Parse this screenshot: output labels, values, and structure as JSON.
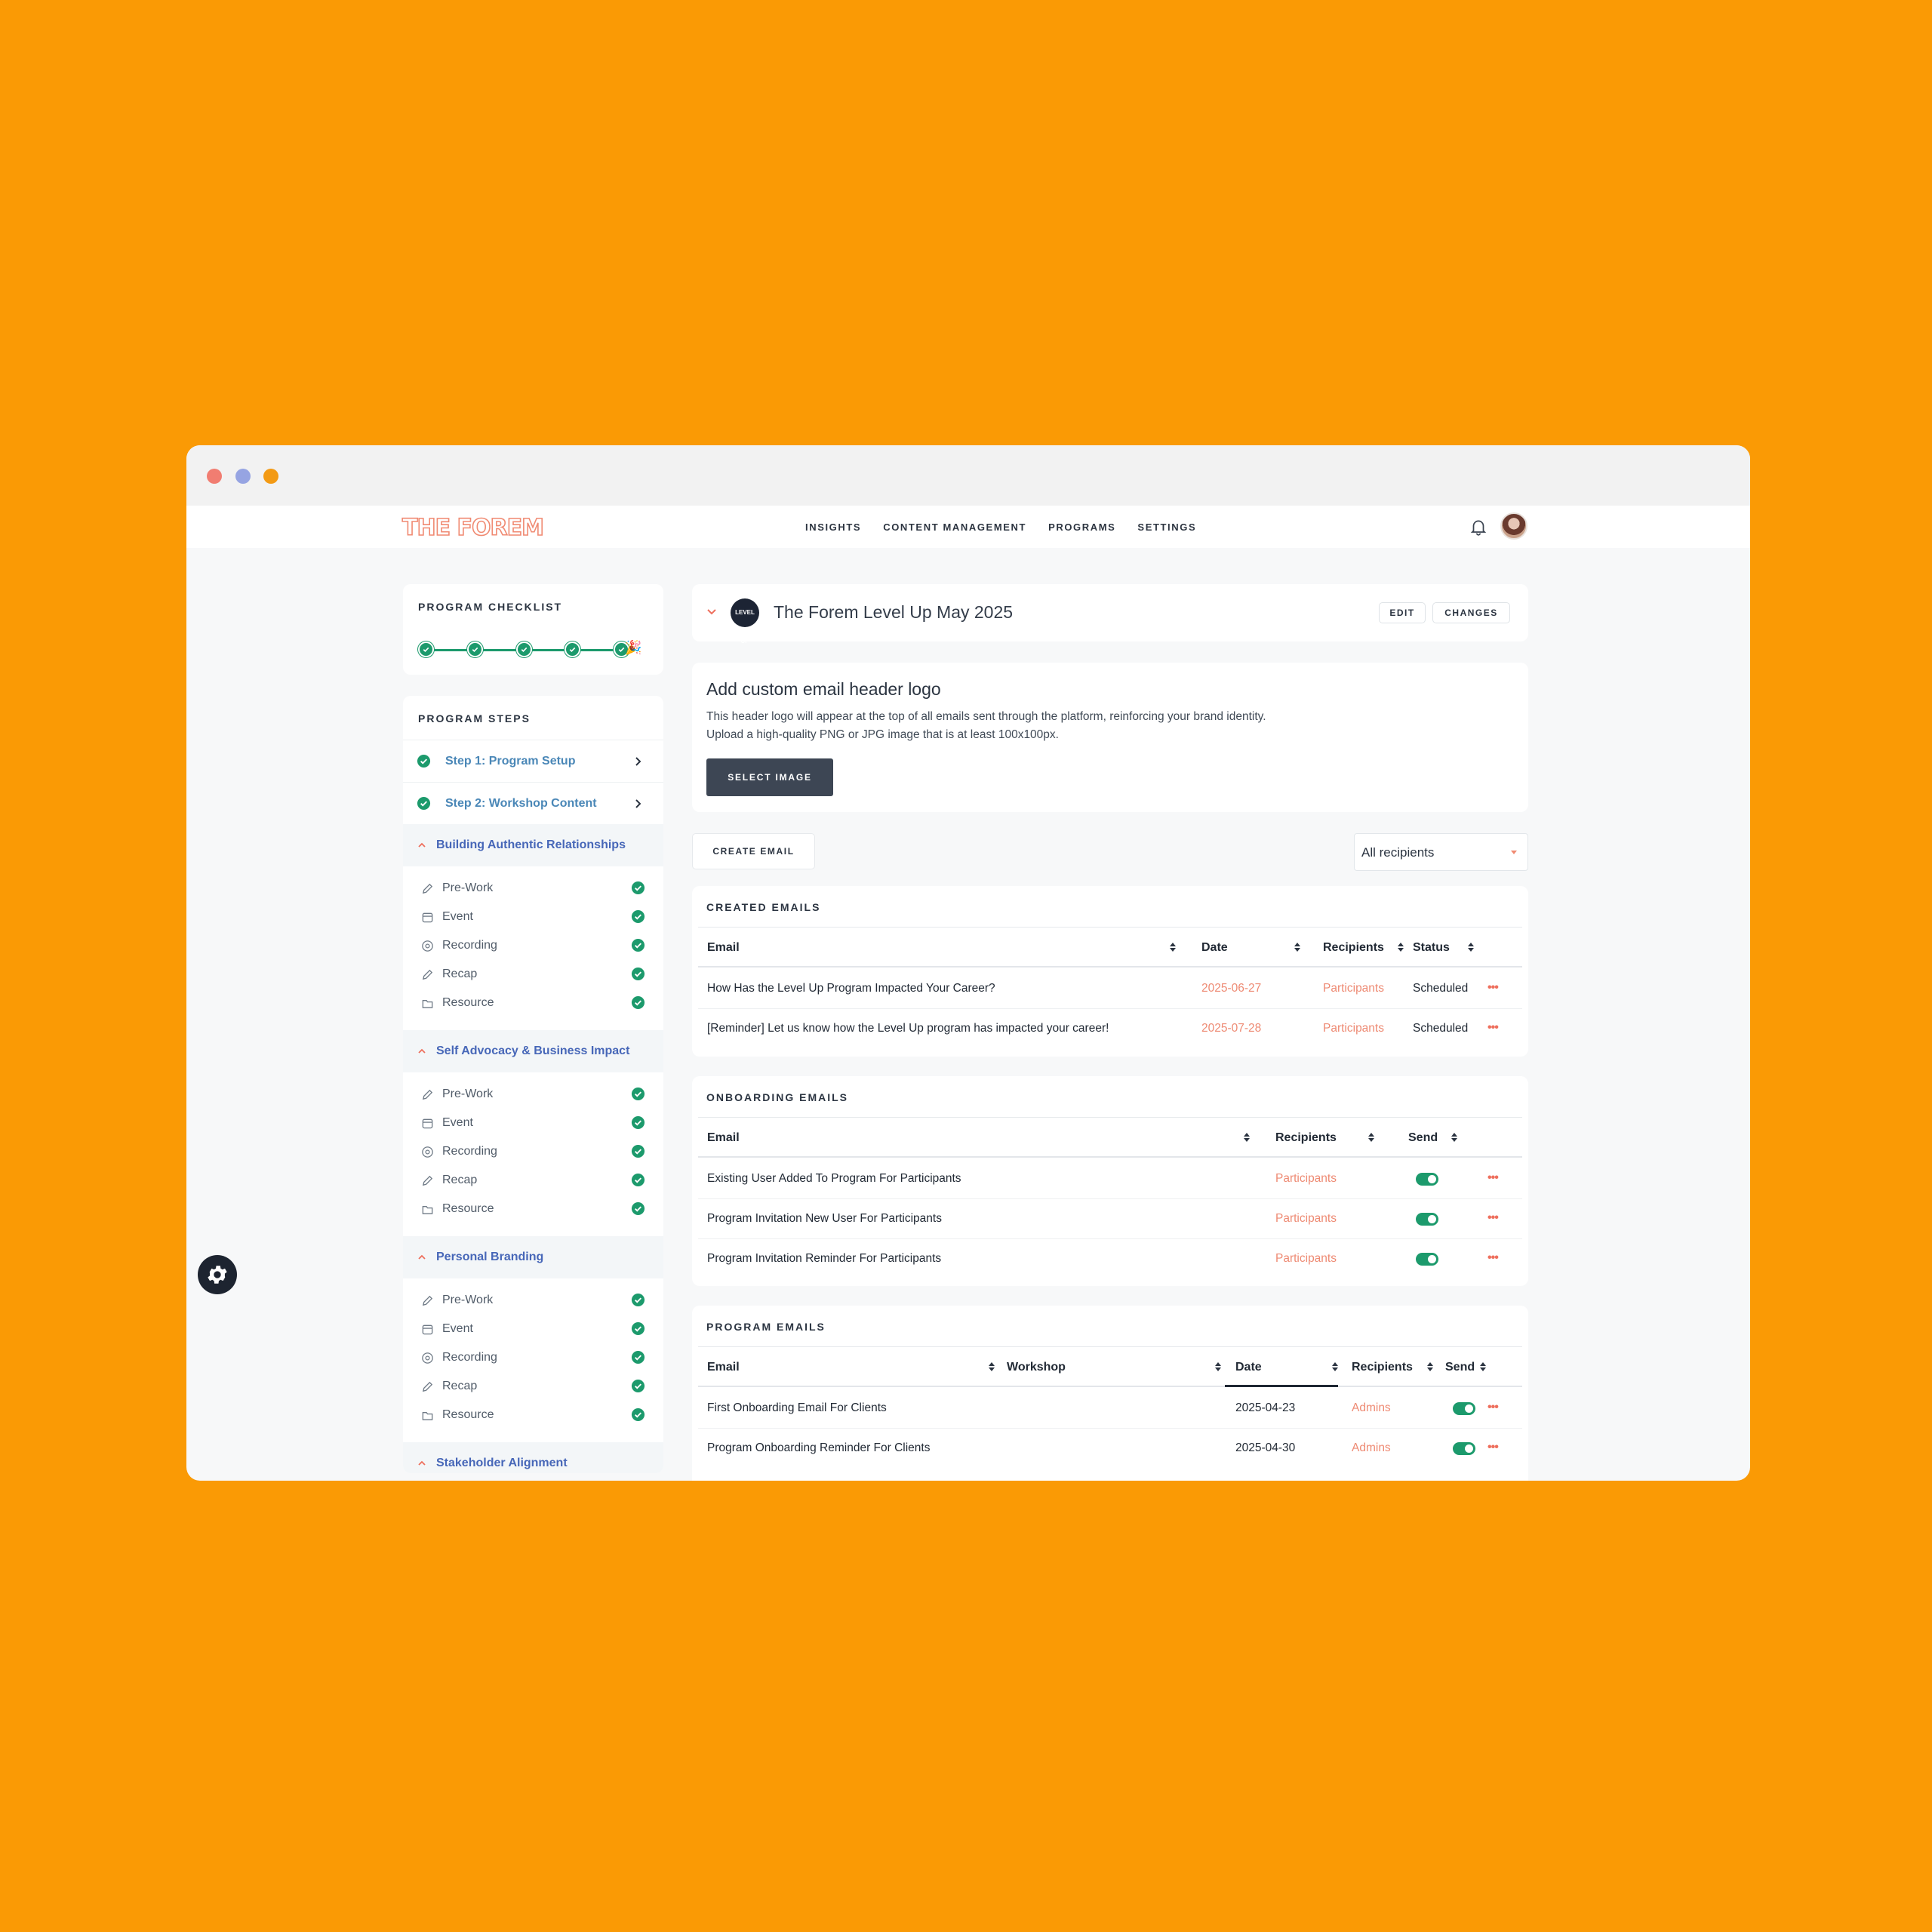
{
  "nav": {
    "logo": "THE FOREM",
    "items": [
      "INSIGHTS",
      "CONTENT MANAGEMENT",
      "PROGRAMS",
      "SETTINGS"
    ]
  },
  "checklist": {
    "title": "PROGRAM CHECKLIST",
    "completed_steps": 5,
    "total_steps": 5
  },
  "steps": {
    "title": "PROGRAM STEPS",
    "step1": "Step 1: Program Setup",
    "step2": "Step 2: Workshop Content",
    "groups": [
      {
        "label": "Building Authentic Relationships",
        "items": [
          "Pre-Work",
          "Event",
          "Recording",
          "Recap",
          "Resource"
        ]
      },
      {
        "label": "Self Advocacy & Business Impact",
        "items": [
          "Pre-Work",
          "Event",
          "Recording",
          "Recap",
          "Resource"
        ]
      },
      {
        "label": "Personal Branding",
        "items": [
          "Pre-Work",
          "Event",
          "Recording",
          "Recap",
          "Resource"
        ]
      },
      {
        "label": "Stakeholder Alignment",
        "items": []
      }
    ]
  },
  "program": {
    "title": "The Forem Level Up May 2025",
    "edit_label": "EDIT",
    "changes_label": "CHANGES",
    "logo_text": "LEVEL UP"
  },
  "logo_card": {
    "heading": "Add custom email header logo",
    "line1": "This header logo will appear at the top of all emails sent through the platform, reinforcing your brand identity.",
    "line2": "Upload a high-quality PNG or JPG image that is at least 100x100px.",
    "button": "SELECT IMAGE"
  },
  "actions": {
    "create_email": "CREATE EMAIL",
    "recipients_filter": "All recipients"
  },
  "created_emails": {
    "title": "CREATED EMAILS",
    "headers": {
      "email": "Email",
      "date": "Date",
      "recipients": "Recipients",
      "status": "Status"
    },
    "rows": [
      {
        "email": "How Has the Level Up Program Impacted Your Career?",
        "date": "2025-06-27",
        "recipients": "Participants",
        "status": "Scheduled"
      },
      {
        "email": "[Reminder] Let us know how the Level Up program has impacted your career!",
        "date": "2025-07-28",
        "recipients": "Participants",
        "status": "Scheduled"
      }
    ]
  },
  "onboarding_emails": {
    "title": "ONBOARDING EMAILS",
    "headers": {
      "email": "Email",
      "recipients": "Recipients",
      "send": "Send"
    },
    "rows": [
      {
        "email": "Existing User Added To Program For Participants",
        "recipients": "Participants",
        "send": true
      },
      {
        "email": "Program Invitation New User For Participants",
        "recipients": "Participants",
        "send": true
      },
      {
        "email": "Program Invitation Reminder For Participants",
        "recipients": "Participants",
        "send": true
      }
    ]
  },
  "program_emails": {
    "title": "PROGRAM EMAILS",
    "headers": {
      "email": "Email",
      "workshop": "Workshop",
      "date": "Date",
      "recipients": "Recipients",
      "send": "Send"
    },
    "rows": [
      {
        "email": "First Onboarding Email For Clients",
        "workshop": "",
        "date": "2025-04-23",
        "recipients": "Admins",
        "send": true
      },
      {
        "email": "Program Onboarding Reminder For Clients",
        "workshop": "",
        "date": "2025-04-30",
        "recipients": "Admins",
        "send": true
      }
    ]
  },
  "more_actions": "•••",
  "colors": {
    "background": "#FA9A05",
    "accent": "#ee8a73",
    "success": "#1c9a6c",
    "link": "#4a87b7"
  }
}
